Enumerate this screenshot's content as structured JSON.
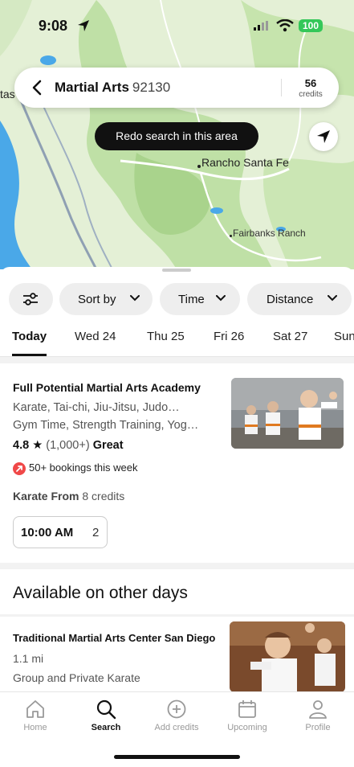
{
  "status_bar": {
    "time": "9:08",
    "battery": "100"
  },
  "search": {
    "title": "Martial Arts",
    "zip": "92130",
    "credits_value": "56",
    "credits_label": "credits"
  },
  "map": {
    "redo_label": "Redo search in this area",
    "places": [
      "Rancho Santa Fe",
      "Fairbanks Ranch",
      "tas"
    ]
  },
  "filters": {
    "sort_label": "Sort by",
    "time_label": "Time",
    "distance_label": "Distance"
  },
  "days": [
    "Today",
    "Wed 24",
    "Thu 25",
    "Fri 26",
    "Sat 27",
    "Sun"
  ],
  "featured": {
    "name": "Full Potential Martial Arts Academy",
    "line1": "Karate, Tai-chi, Jiu-Jitsu, Judo…",
    "line2": "Gym Time, Strength Training, Yog…",
    "rating": "4.8",
    "rating_count": "(1,000+)",
    "rating_label": "Great",
    "bookings": "50+ bookings this week",
    "price_class": "Karate From",
    "price_credits": "8 credits",
    "slot_time": "10:00 AM",
    "slot_count": "2"
  },
  "other_days": {
    "heading": "Available on other days",
    "name": "Traditional Martial Arts Center San Diego",
    "distance": "1.1 mi",
    "description": "Group and Private Karate"
  },
  "tabs": [
    {
      "label": "Home",
      "icon": "home-icon"
    },
    {
      "label": "Search",
      "icon": "search-icon"
    },
    {
      "label": "Add credits",
      "icon": "add-circle-icon"
    },
    {
      "label": "Upcoming",
      "icon": "calendar-icon"
    },
    {
      "label": "Profile",
      "icon": "person-icon"
    }
  ],
  "colors": {
    "accent": "#111111",
    "trend": "#f04848",
    "battery": "#34c759",
    "map_green": "#b9dca0",
    "map_water": "#4aa8e8"
  }
}
